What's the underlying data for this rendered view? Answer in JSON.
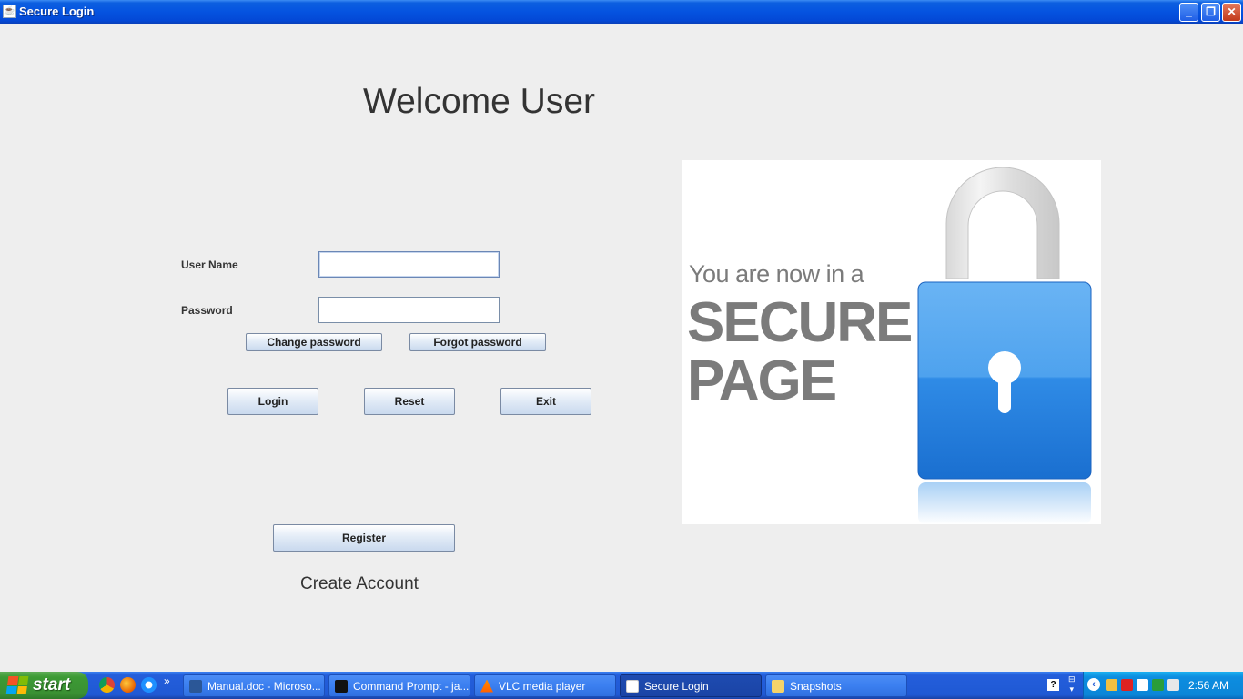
{
  "window": {
    "title": "Secure Login",
    "minimize_glyph": "_",
    "restore_glyph": "❐",
    "close_glyph": "✕"
  },
  "form": {
    "heading": "Welcome User",
    "username_label": "User Name",
    "username_value": "",
    "password_label": "Password",
    "password_value": "",
    "change_password_label": "Change password",
    "forgot_password_label": "Forgot password",
    "login_label": "Login",
    "reset_label": "Reset",
    "exit_label": "Exit",
    "register_label": "Register",
    "create_account_text": "Create Account"
  },
  "banner": {
    "line1": "You are now in a",
    "line2": "SECURE",
    "line3": "PAGE",
    "icon": "padlock-icon"
  },
  "taskbar": {
    "start_label": "start",
    "quick_launch": [
      "chrome-icon",
      "firefox-icon",
      "ie-icon"
    ],
    "quick_launch_more": "»",
    "tasks": [
      {
        "label": "Manual.doc - Microso...",
        "icon": "word-icon",
        "active": false
      },
      {
        "label": "Command Prompt - ja...",
        "icon": "cmd-icon",
        "active": false
      },
      {
        "label": "VLC media player",
        "icon": "vlc-icon",
        "active": false
      },
      {
        "label": "Secure Login",
        "icon": "java-icon",
        "active": true
      },
      {
        "label": "Snapshots",
        "icon": "folder-icon",
        "active": false
      }
    ],
    "help_glyph": "?",
    "clock": "2:56 AM"
  },
  "colors": {
    "background": "#eeeeee",
    "titlebar": "#0553e0",
    "taskbar": "#245edb",
    "start_button": "#3c9a34",
    "lock_blue": "#2f8be6",
    "banner_text": "#7b7b7b"
  }
}
